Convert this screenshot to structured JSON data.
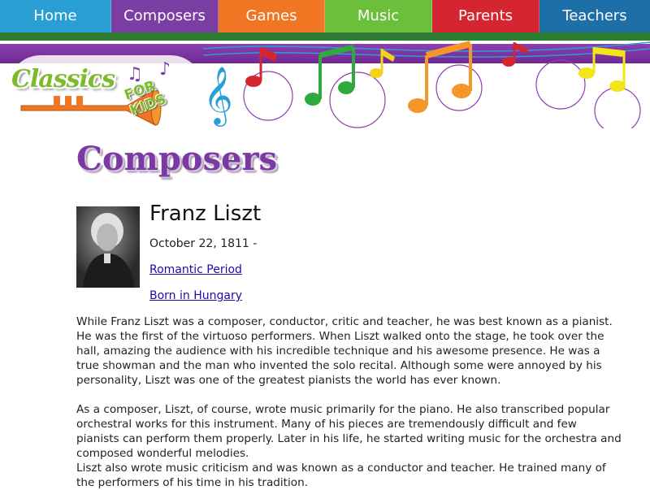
{
  "nav": {
    "items": [
      {
        "label": "Home",
        "color": "#2a9fd6"
      },
      {
        "label": "Composers",
        "color": "#7b3fa3"
      },
      {
        "label": "Games",
        "color": "#f07623"
      },
      {
        "label": "Music",
        "color": "#6bbf3b"
      },
      {
        "label": "Parents",
        "color": "#d42531"
      },
      {
        "label": "Teachers",
        "color": "#1e6fa8"
      }
    ]
  },
  "logo": {
    "text": "Classics",
    "badge": "FOR KIDS",
    "icon": "trumpet-icon"
  },
  "page": {
    "heading": "Composers"
  },
  "composer": {
    "name": "Franz Liszt",
    "dates": "October 22, 1811 -",
    "period_link": "Romantic Period",
    "country_link": "Born in Hungary",
    "portrait": "portrait-photo"
  },
  "bio": {
    "p1": "While Franz Liszt was a composer, conductor, critic and teacher, he was best known as a pianist. He was the first of the virtuoso performers. When Liszt walked onto the stage, he took over the hall, amazing the audience with his incredible technique and his awesome presence. He was a true showman and the man who invented the solo recital. Although some were annoyed by his personality, Liszt was one of the greatest pianists the world has ever known.",
    "p2": "As a composer, Liszt, of course, wrote music primarily for the piano. He also transcribed popular orchestral works for this instrument. Many of his pieces are tremendously difficult and few pianists can perform them properly. Later in his life, he started writing music for the orchestra and composed wonderful melodies.",
    "p3": "Liszt also wrote music criticism and was known as a conductor and teacher. He trained many of the performers of his time in his tradition."
  }
}
